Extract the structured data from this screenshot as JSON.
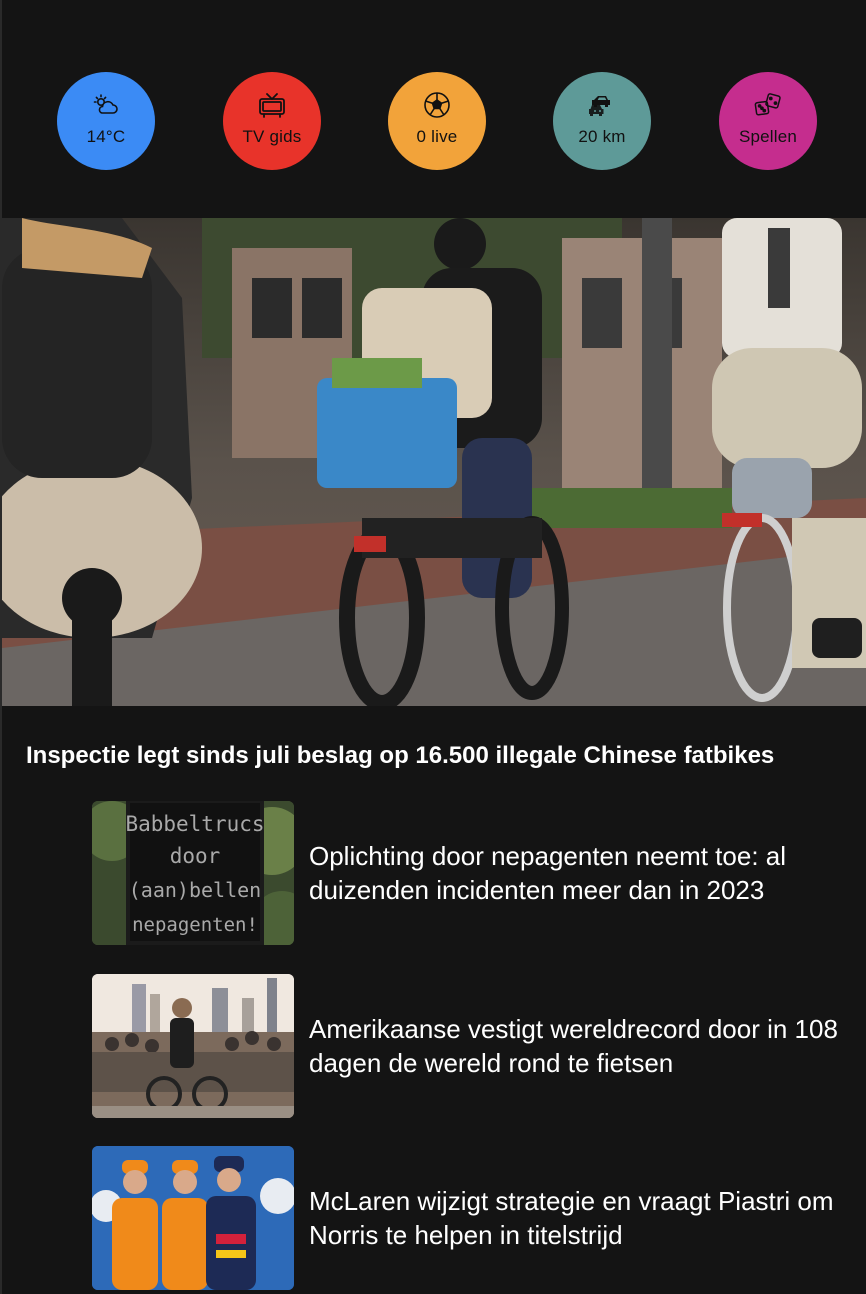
{
  "quick_access": [
    {
      "id": "weather",
      "label": "14°C",
      "icon": "weather-partly-cloudy-icon",
      "color": "#3b8bf5"
    },
    {
      "id": "tv",
      "label": "TV gids",
      "icon": "tv-icon",
      "color": "#e8332a"
    },
    {
      "id": "live",
      "label": "0 live",
      "icon": "soccer-ball-icon",
      "color": "#f2a33a"
    },
    {
      "id": "traffic",
      "label": "20 km",
      "icon": "traffic-cars-icon",
      "color": "#5e9a98"
    },
    {
      "id": "games",
      "label": "Spellen",
      "icon": "dice-icon",
      "color": "#c52d8e"
    }
  ],
  "hero": {
    "image": "cyclists-on-bike-path-photo",
    "headline": "Inspectie legt sinds juli beslag op 16.500 illegale Chinese fatbikes"
  },
  "articles": [
    {
      "title": "Oplichting door nepagenten neemt toe: al duizenden incidenten meer dan in 2023",
      "thumb": "led-sign-photo",
      "sign_text": [
        "Babbeltrucs",
        "door",
        "(aan)bellen",
        "nepagenten!"
      ]
    },
    {
      "title": "Amerikaanse vestigt wereldrecord door in 108 dagen de wereld rond te fietsen",
      "thumb": "cyclist-crowd-photo"
    },
    {
      "title": "McLaren wijzigt strategie en vraagt Piastri om Norris te helpen in titelstrijd",
      "thumb": "f1-drivers-photo"
    }
  ],
  "colors": {
    "background": "#141414",
    "text": "#ffffff"
  }
}
